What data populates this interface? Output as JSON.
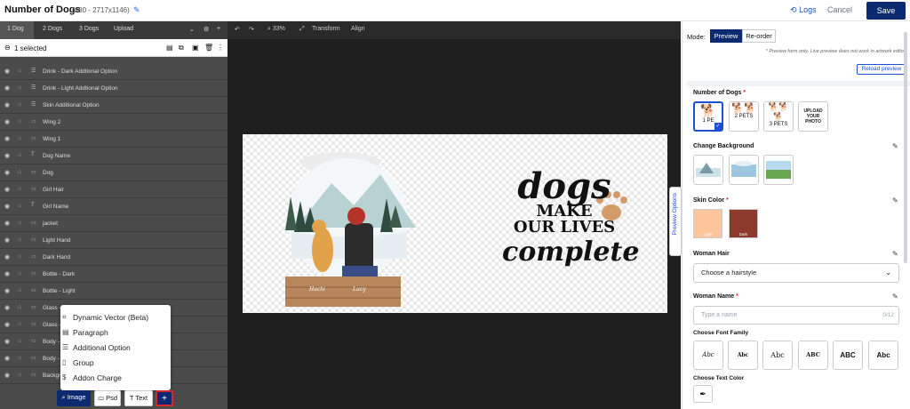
{
  "header": {
    "title": "Number of Dogs",
    "subtitle": "(#80 - 2717x1146)",
    "logs_label": "Logs",
    "cancel_label": "Cancel",
    "save_label": "Save"
  },
  "product_tabs": [
    "1 Dog",
    "2 Dogs",
    "3 Dogs",
    "Upload"
  ],
  "canvas_toolbar": {
    "zoom": "33%",
    "transform_label": "Transform",
    "align_label": "Align"
  },
  "selection_text": "1 selected",
  "layers": [
    "Drink - Dark Addtional Option",
    "Drink - Light Addtional Option",
    "Skin Additional Option",
    "Wing 2",
    "Wing 1",
    "Dog Name",
    "Dog",
    "Girl Hair",
    "Girl Name",
    "jacket",
    "Light Hand",
    "Dark Hand",
    "Bottle - Dark",
    "Bottle - Light",
    "Glass - ",
    "Glass - ",
    "Body - ",
    "Body - ",
    "Backgr"
  ],
  "add_menu": [
    "Dynamic Vector (Beta)",
    "Paragraph",
    "Additional Option",
    "Group",
    "Addon Charge"
  ],
  "add_buttons": {
    "image": "Image",
    "psd": "Psd",
    "text": "Text",
    "plus": "+"
  },
  "artwork": {
    "line1": "dogs",
    "line2": "MAKE",
    "line3": "OUR LIVES",
    "line4": "complete",
    "dog_name": "Hachi",
    "girl_name": "Lucy"
  },
  "preview_tab_label": "Preview Options",
  "panel": {
    "mode_label": "Mode:",
    "mode_preview": "Preview",
    "mode_reorder": "Re-order",
    "note": "* Preview form only. Live preview does not work in artwork editor.",
    "reload_label": "Reload preview",
    "number_of_dogs_label": "Number of Dogs",
    "pet_options": [
      "1 PE",
      "2 PETS",
      "3 PETS",
      "UPLOAD YOUR PHOTO"
    ],
    "change_background_label": "Change Background",
    "skin_color_label": "Skin Color",
    "skin_options": [
      "Light",
      "Dark"
    ],
    "woman_hair_label": "Woman Hair",
    "hair_placeholder": "Choose a hairstyle",
    "woman_name_label": "Woman Name",
    "name_placeholder": "Type a name",
    "name_counter": "0/12",
    "font_family_label": "Choose Font Family",
    "font_samples": [
      "Abc",
      "Abc",
      "Abc",
      "ABC",
      "ABC",
      "Abc"
    ],
    "text_color_label": "Choose Text Color"
  },
  "colors": {
    "primary": "#0b2a6f",
    "accent": "#2563eb",
    "skin_light": "#fcc59c",
    "skin_dark": "#8b3a2c",
    "required": "#dc2626"
  }
}
